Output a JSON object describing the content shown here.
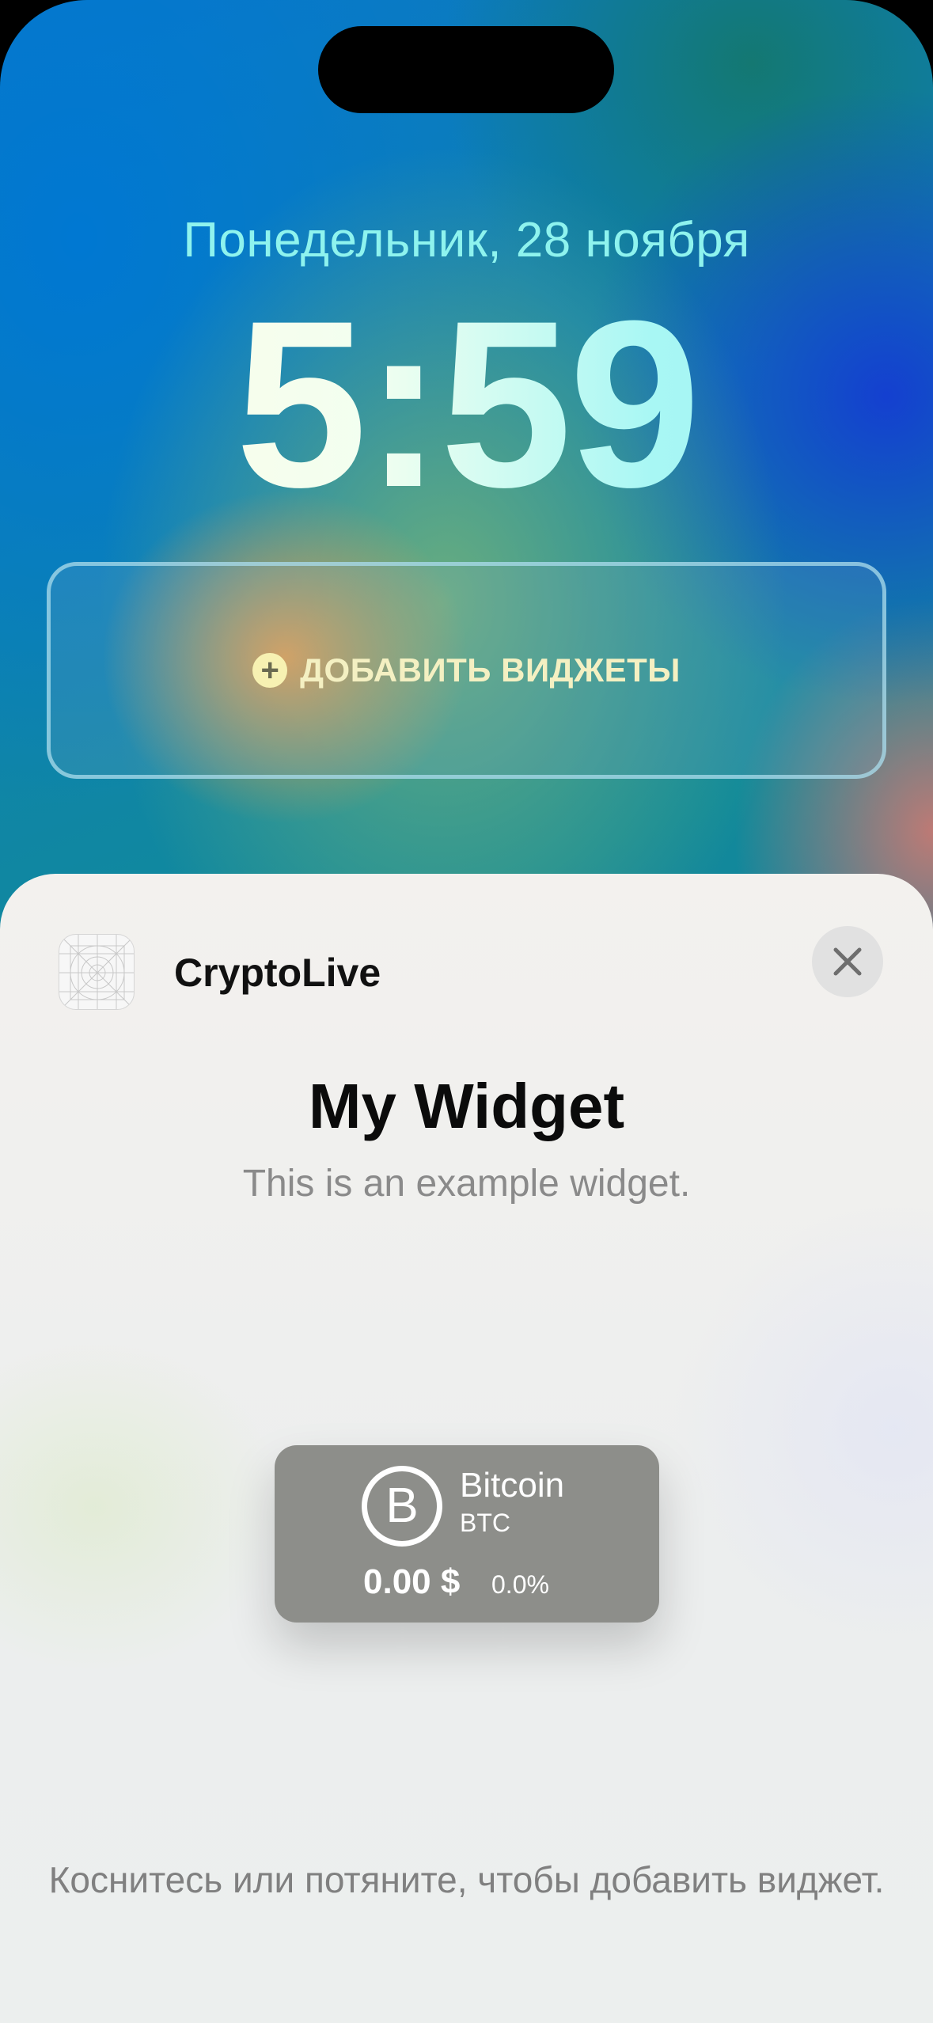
{
  "lockscreen": {
    "date": "Понедельник, 28 ноября",
    "time": "5:59",
    "add_widgets_label": "ДОБАВИТЬ ВИДЖЕТЫ",
    "plus_icon": "plus-circle-icon"
  },
  "sheet": {
    "app_name": "CryptoLive",
    "app_icon": "app-placeholder-icon",
    "close_icon": "close-icon",
    "widget_title": "My Widget",
    "widget_description": "This is an example widget.",
    "hint": "Коснитесь или потяните, чтобы добавить виджет."
  },
  "widget": {
    "coin_icon_letter": "B",
    "coin_name": "Bitcoin",
    "coin_ticker": "BTC",
    "price": "0.00 $",
    "change": "0.0%"
  },
  "colors": {
    "date_text": "#8ef3ee",
    "add_widget_text": "#f4f0c2",
    "widget_background": "#8d8e8a",
    "sheet_background": "#eceeee"
  }
}
